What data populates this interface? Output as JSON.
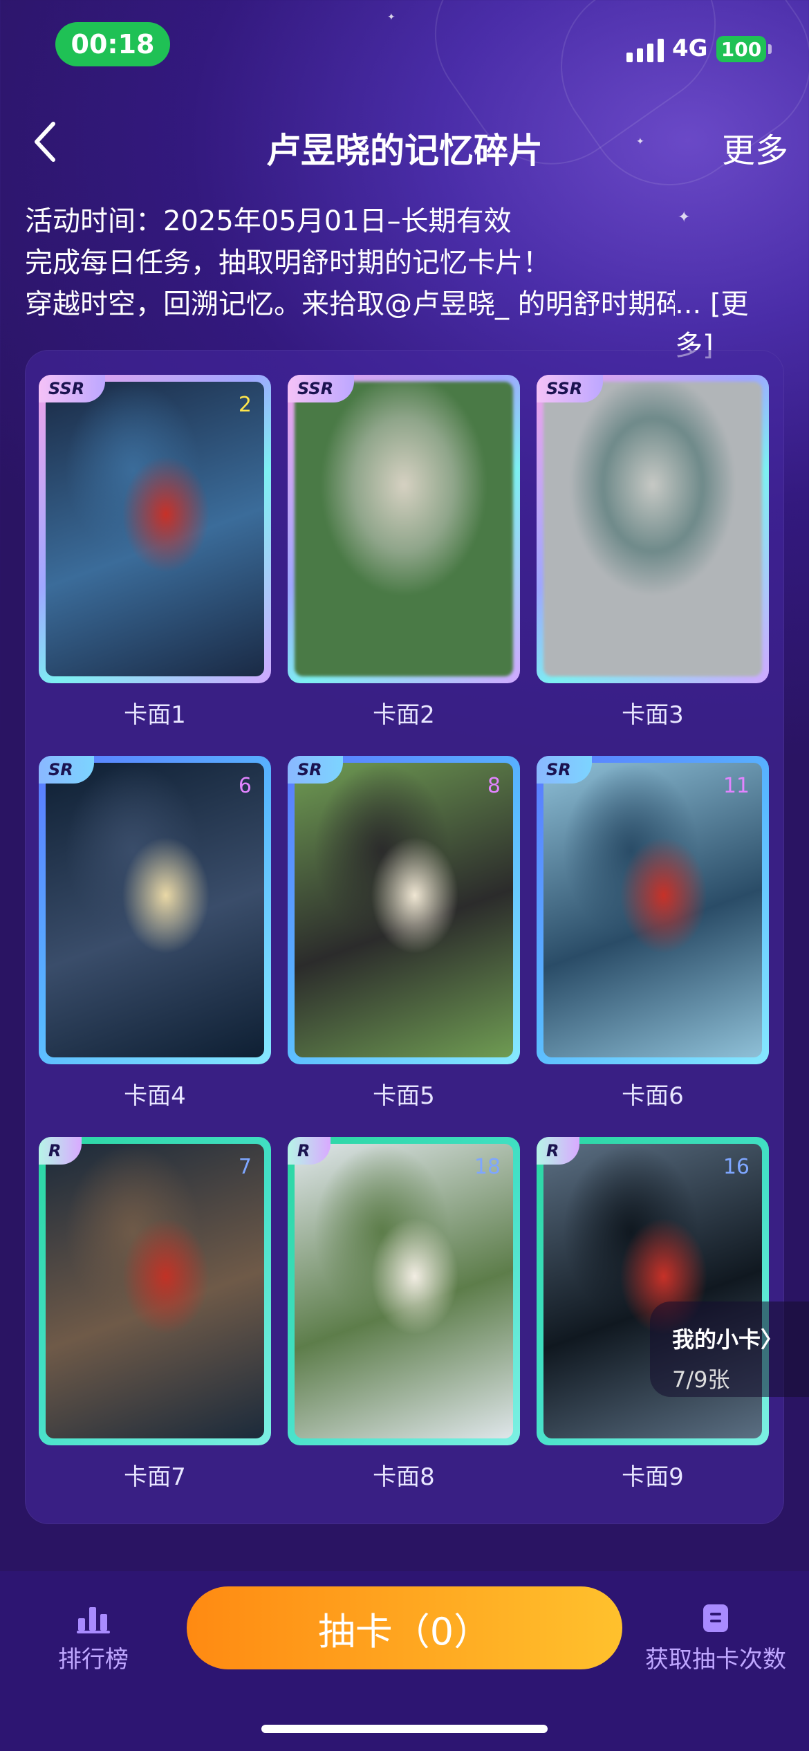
{
  "status": {
    "time": "00:18",
    "network": "4G",
    "battery": "100"
  },
  "nav": {
    "title": "卢昱晓的记忆碎片",
    "more": "更多"
  },
  "description": {
    "line1": "活动时间：2025年05月01日–长期有效",
    "line2": "完成每日任务，抽取明舒时期的记忆卡片！",
    "line3": "穿越时空，回溯记忆。来拾取@卢昱晓_ 的明舒时期碎",
    "more": "... [更多]"
  },
  "cards": [
    {
      "label": "卡面1",
      "rarity": "SSR",
      "count": "2",
      "locked": false,
      "colors": [
        "#1a2a45",
        "#c73128",
        "#3b6c9a"
      ]
    },
    {
      "label": "卡面2",
      "rarity": "SSR",
      "count": "",
      "locked": true,
      "colors": [
        "#8fa58a",
        "#d6d1c2",
        "#4a7a46"
      ]
    },
    {
      "label": "卡面3",
      "rarity": "SSR",
      "count": "",
      "locked": true,
      "colors": [
        "#6f8a8a",
        "#c7c9c5",
        "#b1b5b8"
      ]
    },
    {
      "label": "卡面4",
      "rarity": "SR",
      "count": "6",
      "locked": false,
      "colors": [
        "#0e1f33",
        "#e9d8a6",
        "#3a4d6a"
      ]
    },
    {
      "label": "卡面5",
      "rarity": "SR",
      "count": "8",
      "locked": false,
      "colors": [
        "#6f9c53",
        "#efe6d3",
        "#2b2b2b"
      ]
    },
    {
      "label": "卡面6",
      "rarity": "SR",
      "count": "11",
      "locked": false,
      "colors": [
        "#8fc0d7",
        "#c73128",
        "#2a4c67"
      ]
    },
    {
      "label": "卡面7",
      "rarity": "R",
      "count": "7",
      "locked": false,
      "colors": [
        "#1b2a3b",
        "#c13226",
        "#6f5a48"
      ]
    },
    {
      "label": "卡面8",
      "rarity": "R",
      "count": "18",
      "locked": false,
      "colors": [
        "#dfe6ea",
        "#f2ede3",
        "#5d7d4a"
      ]
    },
    {
      "label": "卡面9",
      "rarity": "R",
      "count": "16",
      "locked": false,
      "colors": [
        "#5b6f83",
        "#c73128",
        "#101820"
      ]
    }
  ],
  "my_cards": {
    "title": "我的小卡",
    "chevron": "〉",
    "progress_text": "7/9张",
    "collected": 7,
    "total": 9
  },
  "bottom": {
    "leaderboard": "排行榜",
    "draw_button": "抽卡（0）",
    "get_draws": "获取抽卡次数"
  },
  "icons": {
    "back": "chevron-left-icon",
    "leaderboard": "bar-chart-icon",
    "get_draws": "document-icon"
  },
  "colors": {
    "accent": "#ff9f1a",
    "status_green": "#1fc155",
    "bottom_icon": "#bfa7ff"
  }
}
